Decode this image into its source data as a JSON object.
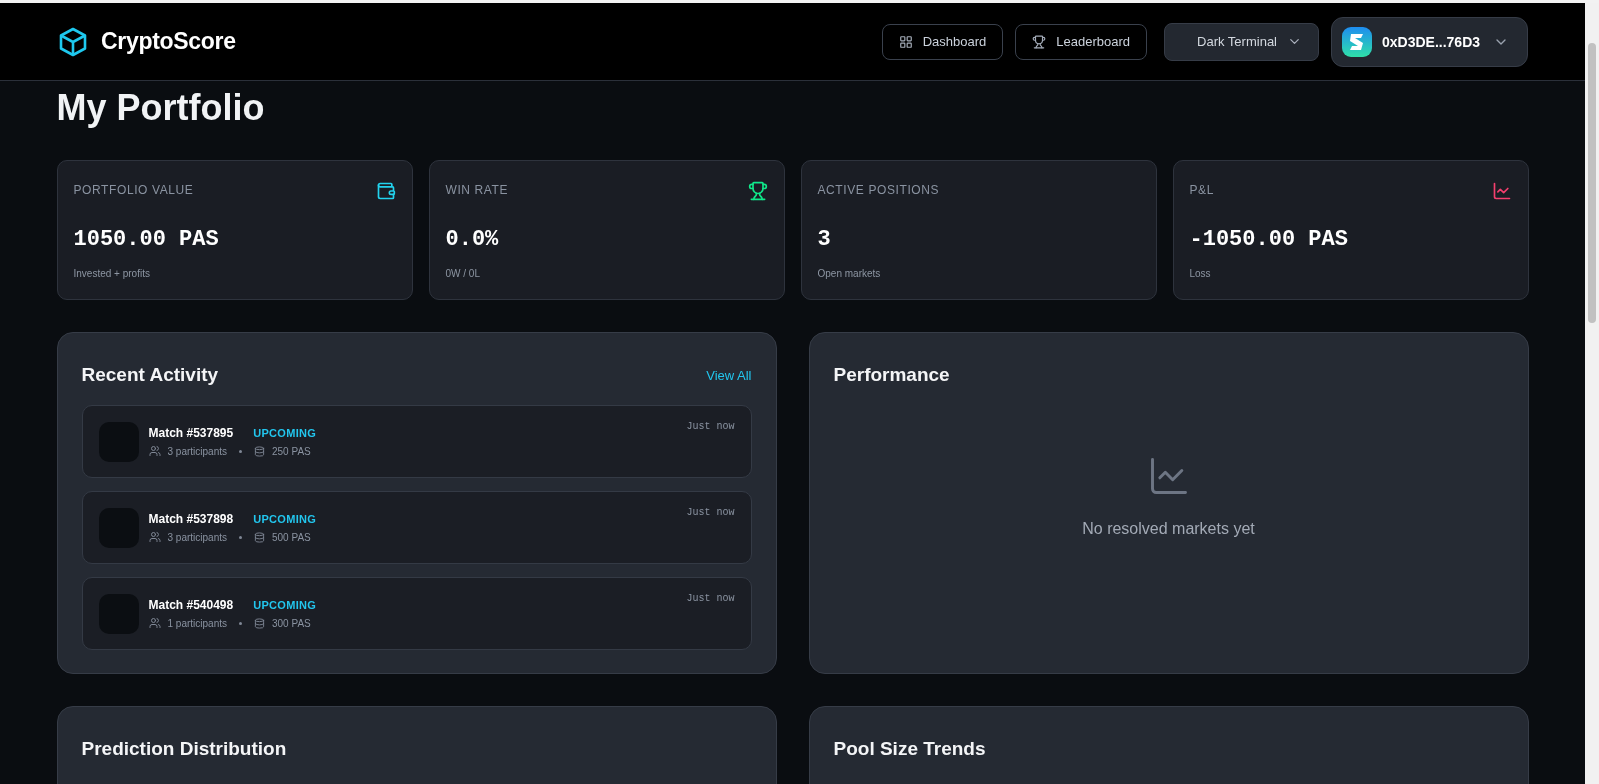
{
  "header": {
    "logo": "CryptoScore",
    "nav": [
      {
        "label": "Dashboard",
        "kind": "grid"
      },
      {
        "label": "Leaderboard",
        "kind": "trophy"
      }
    ],
    "theme_select": {
      "value": "Dark Terminal"
    },
    "wallet": {
      "address": "0xD3DE...76D3"
    }
  },
  "page_title": "My Portfolio",
  "stats": [
    {
      "label": "PORTFOLIO VALUE",
      "value": "1050.00 PAS",
      "note": "Invested + profits",
      "kind": "wallet"
    },
    {
      "label": "WIN RATE",
      "value": "0.0%",
      "note": "0W / 0L",
      "kind": "trophy"
    },
    {
      "label": "ACTIVE POSITIONS",
      "value": "3",
      "note": "Open markets",
      "kind": "plain"
    },
    {
      "label": "P&L",
      "value": "-1050.00 PAS",
      "note": "Loss",
      "kind": "chart"
    }
  ],
  "recent_activity": {
    "title": "Recent Activity",
    "link": "View All",
    "items": [
      {
        "title": "Match #537895",
        "status": "UPCOMING",
        "participants": "3 participants",
        "pool": "250 PAS",
        "time": "Just now"
      },
      {
        "title": "Match #537898",
        "status": "UPCOMING",
        "participants": "3 participants",
        "pool": "500 PAS",
        "time": "Just now"
      },
      {
        "title": "Match #540498",
        "status": "UPCOMING",
        "participants": "1 participants",
        "pool": "300 PAS",
        "time": "Just now"
      }
    ]
  },
  "performance": {
    "title": "Performance",
    "empty_message": "No resolved markets yet"
  },
  "bottom_panels": [
    {
      "title": "Prediction Distribution"
    },
    {
      "title": "Pool Size Trends"
    }
  ]
}
